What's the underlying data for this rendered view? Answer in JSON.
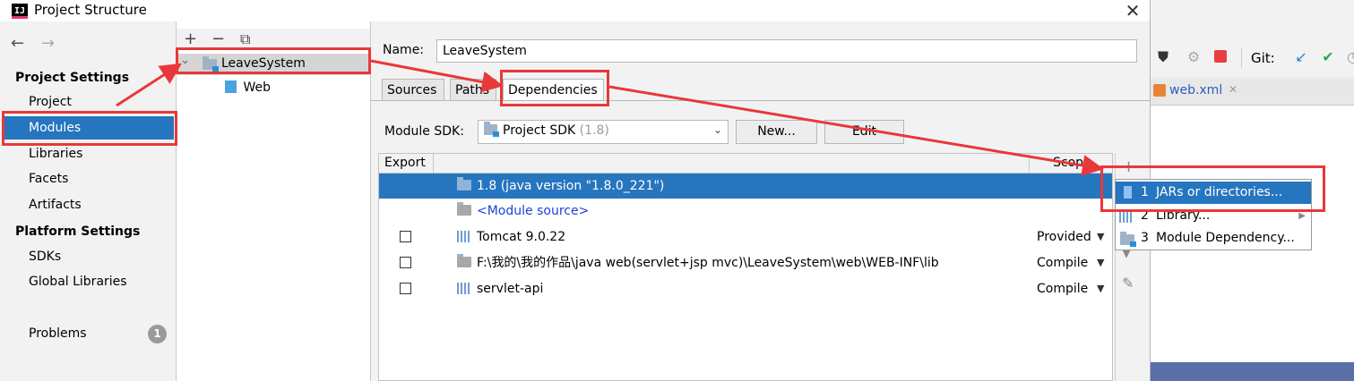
{
  "window": {
    "title": "Project Structure",
    "close_glyph": "✕",
    "app_icon_text": "IJ"
  },
  "nav": {
    "back_glyph": "←",
    "forward_glyph": "→",
    "project_settings_heading": "Project Settings",
    "project_settings_items": [
      "Project",
      "Modules",
      "Libraries",
      "Facets",
      "Artifacts"
    ],
    "selected_item": "Modules",
    "platform_settings_heading": "Platform Settings",
    "platform_settings_items": [
      "SDKs",
      "Global Libraries"
    ],
    "problems_label": "Problems",
    "problems_count": "1"
  },
  "tree": {
    "toolbar": {
      "add": "+",
      "remove": "−",
      "copy": "⧉"
    },
    "expand_glyph": "⌄",
    "module_name": "LeaveSystem",
    "child_name": "Web"
  },
  "module": {
    "name_label": "Name:",
    "name_value": "LeaveSystem",
    "tabs": [
      "Sources",
      "Paths",
      "Dependencies"
    ],
    "active_tab": "Dependencies",
    "sdk_label": "Module SDK:",
    "sdk_value": "Project SDK",
    "sdk_version": "(1.8)",
    "new_button": "New...",
    "edit_button": "Edit"
  },
  "dependencies": {
    "header_export": "Export",
    "header_scope": "Scope",
    "rows": [
      {
        "name": "1.8 (java version \"1.8.0_221\")",
        "scope": "",
        "checkbox": false
      },
      {
        "name": "<Module source>",
        "scope": "",
        "checkbox": false
      },
      {
        "name": "Tomcat 9.0.22",
        "scope": "Provided",
        "checkbox": true
      },
      {
        "name": "F:\\我的\\我的作品\\java web(servlet+jsp mvc)\\LeaveSystem\\web\\WEB-INF\\lib",
        "scope": "Compile",
        "checkbox": true
      },
      {
        "name": "servlet-api",
        "scope": "Compile",
        "checkbox": true
      }
    ]
  },
  "side_toolbar": {
    "add": "+",
    "down": "▼",
    "edit": "✎"
  },
  "popup": {
    "items": [
      {
        "num": "1",
        "label": "JARs or directories..."
      },
      {
        "num": "2",
        "label": "Library...",
        "submenu": "▶"
      },
      {
        "num": "3",
        "label": "Module Dependency..."
      }
    ]
  },
  "ide": {
    "git_label": "Git:",
    "tab_label": "web.xml",
    "tab_close": "✕"
  },
  "colors": {
    "selection": "#2675bf",
    "annotation_red": "#e8383a",
    "link_blue": "#1a44d8"
  }
}
